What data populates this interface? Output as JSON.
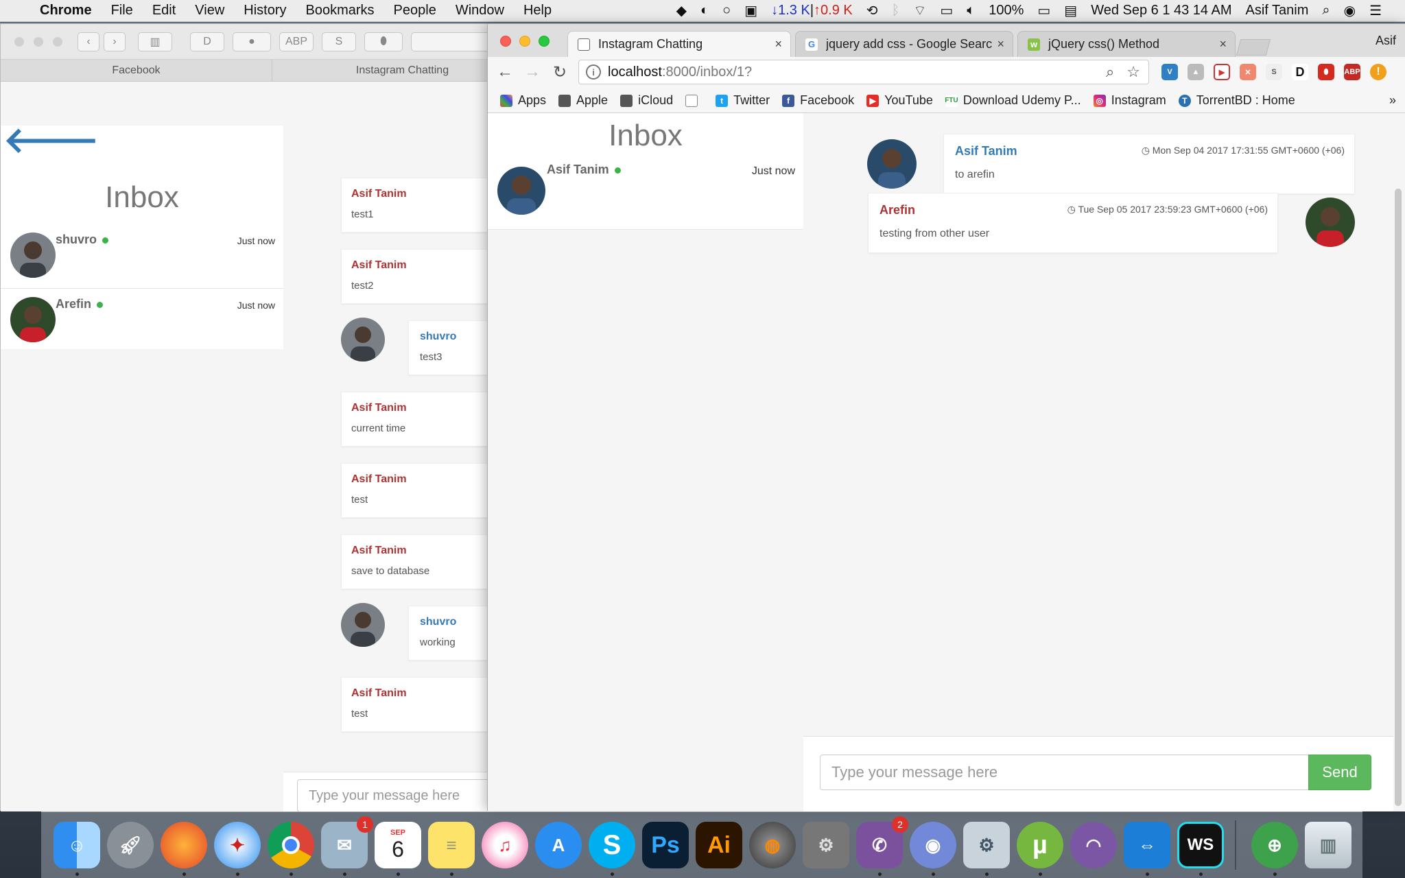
{
  "menubar": {
    "app_name": "Chrome",
    "items": [
      "File",
      "Edit",
      "View",
      "History",
      "Bookmarks",
      "People",
      "Window",
      "Help"
    ],
    "net_down": "↓1.3 K",
    "net_separator": "|",
    "net_up": "↑0.9 K",
    "battery": "100%",
    "datetime": "Wed Sep 6  1 43 14 AM",
    "user": "Asif Tanim"
  },
  "back_window": {
    "tabs": [
      "Facebook",
      "Instagram Chatting"
    ],
    "sidebar_title": "Inbox",
    "contacts": [
      {
        "name": "shuvro",
        "time": "Just now"
      },
      {
        "name": "Arefin",
        "time": "Just now"
      }
    ],
    "messages": [
      {
        "name": "Asif Tanim",
        "text": "test1"
      },
      {
        "name": "Asif Tanim",
        "text": "test2"
      },
      {
        "name": "shuvro",
        "text": "test3"
      },
      {
        "name": "Asif Tanim",
        "text": "current time"
      },
      {
        "name": "Asif Tanim",
        "text": "test"
      },
      {
        "name": "Asif Tanim",
        "text": "save to database"
      },
      {
        "name": "shuvro",
        "text": "working"
      },
      {
        "name": "Asif Tanim",
        "text": "test"
      }
    ],
    "input_placeholder": "Type your message here"
  },
  "front_window": {
    "tabs": [
      {
        "title": "Instagram Chatting",
        "close": "×"
      },
      {
        "title": "jquery add css - Google Searc",
        "close": "×"
      },
      {
        "title": "jQuery css() Method",
        "close": "×"
      }
    ],
    "profile": "Asif",
    "url_host": "localhost",
    "url_path": ":8000/inbox/1?",
    "bookmarks": [
      "Apps",
      "Apple",
      "iCloud",
      "Twitter",
      "Facebook",
      "YouTube",
      "Download Udemy P...",
      "Instagram",
      "TorrentBD : Home"
    ],
    "bookmarks_more": "»",
    "page": {
      "sidebar_title": "Inbox",
      "contact": {
        "name": "Asif Tanim",
        "time": "Just now"
      },
      "messages": [
        {
          "name": "Asif Tanim",
          "timestamp": "Mon Sep 04 2017 17:31:55 GMT+0600 (+06)",
          "text": "to arefin"
        },
        {
          "name": "Arefin",
          "timestamp": "Tue Sep 05 2017 23:59:23 GMT+0600 (+06)",
          "text": "testing from other user"
        }
      ],
      "input_placeholder": "Type your message here",
      "send_label": "Send"
    }
  },
  "dock": {
    "calendar_month": "SEP",
    "calendar_day": "6",
    "mail_badge": "1",
    "viber_badge": "2",
    "items": [
      "finder",
      "launchpad",
      "firefox",
      "safari",
      "chrome",
      "mail",
      "calendar",
      "notes",
      "itunes",
      "app-store",
      "skype",
      "photoshop",
      "illustrator",
      "disk-utility",
      "system-preferences",
      "viber",
      "discord",
      "preferences",
      "utorrent",
      "tunnelbear",
      "teamviewer",
      "webstorm",
      "android-studio",
      "trash"
    ]
  },
  "colors": {
    "send_button": "#5cb85c",
    "sender_red": "#a33333",
    "sender_blue": "#337ab7",
    "online_dot": "#3cb34a"
  }
}
